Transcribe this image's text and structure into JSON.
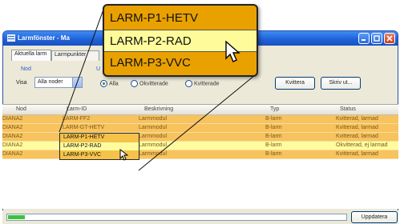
{
  "window": {
    "title": "Larmfönster - Ma",
    "tabs": [
      "Aktuella larm",
      "Larmpunkter"
    ]
  },
  "filter": {
    "group_nod": "Nod",
    "group_u": "U",
    "visa_label": "Visa",
    "select_value": "Alla noder",
    "radios": [
      "Alla",
      "Okvitterade",
      "Kvitterade"
    ],
    "selected_radio": "Alla",
    "kvittera_label": "Kvittera",
    "skriv_ut_label": "Skriv ut..."
  },
  "table": {
    "columns": [
      "Nod",
      "Larm-ID",
      "Beskrivning",
      "Typ",
      "Status"
    ],
    "rows": [
      {
        "nod": "DIANA2",
        "larm_id": "LARM-FF2",
        "beskrivning": "Larmmodul",
        "typ": "B-larm",
        "status": "Kvitterad, larmad"
      },
      {
        "nod": "DIANA2",
        "larm_id": "LARM-GT-HETV",
        "beskrivning": "Larmmodul",
        "typ": "B-larm",
        "status": "Kvitterad, larmad"
      },
      {
        "nod": "DIANA2",
        "larm_id": "LARM-P1-HETV",
        "beskrivning": "Larmmodul",
        "typ": "B-larm",
        "status": "Kvitterad, larmad"
      },
      {
        "nod": "DIANA2",
        "larm_id": "LARM-P2-RAD",
        "beskrivning": "Larmmodul",
        "typ": "B-larm",
        "status": "Okvitterad, ej larmad"
      },
      {
        "nod": "DIANA2",
        "larm_id": "LARM-P3-VVC",
        "beskrivning": "Larmmodul",
        "typ": "B-larm",
        "status": "Kvitterad, larmad"
      }
    ]
  },
  "callout": {
    "items": [
      "LARM-P1-HETV",
      "LARM-P2-RAD",
      "LARM-P3-VVC"
    ],
    "highlighted_item": "LARM-P2-RAD"
  },
  "statusbar": {
    "update_label": "Uppdatera",
    "progress_fraction": 0.05
  },
  "colors": {
    "row_orange": "#f8c35d",
    "row_highlight": "#fefc9e",
    "callout_orange": "#e9a100",
    "titlebar_blue": "#2463d9",
    "progress_green": "#3cc23c"
  }
}
